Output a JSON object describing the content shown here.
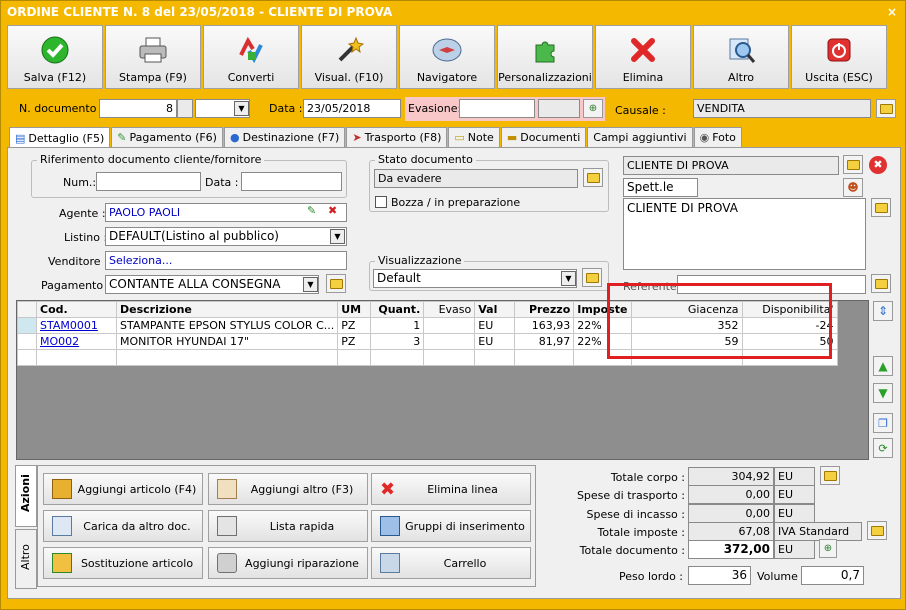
{
  "window": {
    "title": "ORDINE CLIENTE N. 8 del 23/05/2018 - CLIENTE DI PROVA",
    "close": "×"
  },
  "toolbar": [
    {
      "label": "Salva (F12)",
      "icon": "check-icon"
    },
    {
      "label": "Stampa (F9)",
      "icon": "printer-icon"
    },
    {
      "label": "Converti",
      "icon": "convert-icon"
    },
    {
      "label": "Visual. (F10)",
      "icon": "wand-icon"
    },
    {
      "label": "Navigatore",
      "icon": "compass-icon"
    },
    {
      "label": "Personalizzazioni",
      "icon": "puzzle-icon"
    },
    {
      "label": "Elimina",
      "icon": "delete-icon"
    },
    {
      "label": "Altro",
      "icon": "magnifier-icon"
    },
    {
      "label": "Uscita (ESC)",
      "icon": "exit-icon"
    }
  ],
  "header": {
    "ndoc_label": "N. documento :",
    "ndoc_value": "8",
    "data_label": "Data :",
    "data_value": "23/05/2018",
    "evasione_label": "Evasione:",
    "causale_label": "Causale :",
    "causale_value": "VENDITA"
  },
  "tabs": [
    "Dettaglio (F5)",
    "Pagamento (F6)",
    "Destinazione (F7)",
    "Trasporto (F8)",
    "Note",
    "Documenti",
    "Campi aggiuntivi",
    "Foto"
  ],
  "riferimento": {
    "title": "Riferimento documento cliente/fornitore",
    "num_label": "Num.:",
    "data_label": "Data :"
  },
  "fields": {
    "agente_label": "Agente :",
    "agente_value": "PAOLO PAOLI",
    "listino_label": "Listino :",
    "listino_value": "DEFAULT(Listino al pubblico)",
    "venditore_label": "Venditore :",
    "venditore_value": "Seleziona...",
    "pagamento_label": "Pagamento :",
    "pagamento_value": "CONTANTE ALLA CONSEGNA"
  },
  "stato": {
    "title": "Stato documento",
    "value": "Da evadere",
    "bozza": "Bozza / in preparazione"
  },
  "visualizzazione": {
    "title": "Visualizzazione",
    "value": "Default"
  },
  "cliente": {
    "name": "CLIENTE DI PROVA",
    "title": "Spett.le",
    "address": "CLIENTE DI PROVA",
    "referente_label": "Referente"
  },
  "grid": {
    "headers": [
      "Cod.",
      "Descrizione",
      "UM",
      "Quant.",
      "Evaso",
      "Val",
      "Prezzo",
      "Imposte",
      "Giacenza",
      "Disponibilita'"
    ],
    "rows": [
      [
        "STAM0001",
        "STAMPANTE EPSON STYLUS COLOR C...",
        "PZ",
        "1",
        "",
        "EU",
        "163,93",
        "22%",
        "352",
        "-24"
      ],
      [
        "MO002",
        "MONITOR HYUNDAI 17\"",
        "PZ",
        "3",
        "",
        "EU",
        "81,97",
        "22%",
        "59",
        "50"
      ]
    ]
  },
  "sidetabs": [
    "Azioni",
    "Altro"
  ],
  "actions": [
    "Aggiungi articolo (F4)",
    "Aggiungi altro (F3)",
    "Elimina linea",
    "Carica da altro doc.",
    "Lista rapida",
    "Gruppi di inserimento",
    "Sostituzione articolo",
    "Aggiungi riparazione",
    "Carrello"
  ],
  "totals": {
    "corpo_label": "Totale corpo :",
    "corpo": "304,92",
    "corpo_cur": "EU",
    "trasporto_label": "Spese di trasporto :",
    "trasporto": "0,00",
    "trasporto_cur": "EU",
    "incasso_label": "Spese di incasso :",
    "incasso": "0,00",
    "incasso_cur": "EU",
    "imposte_label": "Totale imposte :",
    "imposte": "67,08",
    "imposte_note": "IVA Standard",
    "documento_label": "Totale documento :",
    "documento": "372,00",
    "documento_cur": "EU",
    "peso_label": "Peso lordo :",
    "peso": "36",
    "volume_label": "Volume :",
    "volume": "0,7"
  },
  "colors": {
    "window": "#f5b800",
    "highlight": "#e02020"
  }
}
